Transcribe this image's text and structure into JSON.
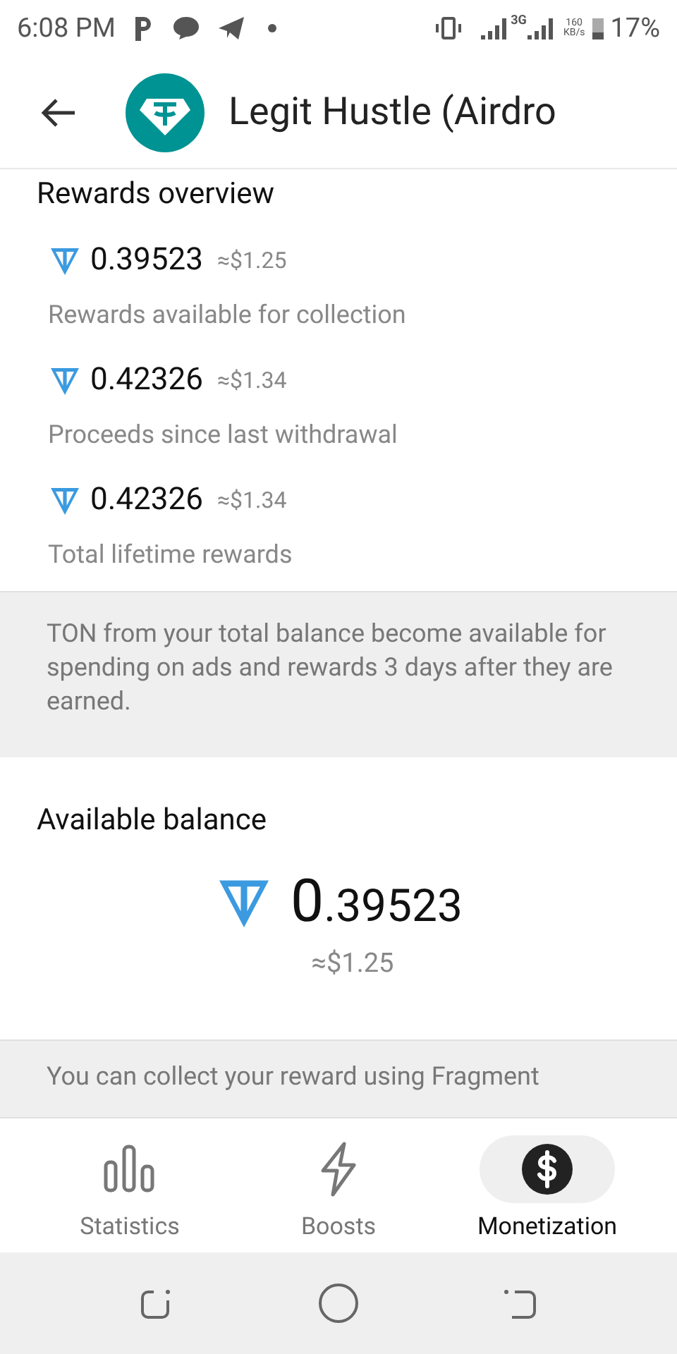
{
  "status_bar": {
    "time": "6:08 PM",
    "network": "3G",
    "speed": "160",
    "speed_unit": "KB/s",
    "battery": "17%"
  },
  "header": {
    "title": "Legit Hustle (Airdro"
  },
  "rewards": {
    "title": "Rewards overview",
    "items": [
      {
        "amount": "0.39523",
        "usd": "≈$1.25",
        "label": "Rewards available for collection"
      },
      {
        "amount": "0.42326",
        "usd": "≈$1.34",
        "label": "Proceeds since last withdrawal"
      },
      {
        "amount": "0.42326",
        "usd": "≈$1.34",
        "label": "Total lifetime rewards"
      }
    ]
  },
  "note": "TON from your total balance become available for spending on ads and rewards 3 days after they are earned.",
  "balance": {
    "title": "Available balance",
    "integer": "0",
    "fraction": ".39523",
    "usd": "≈$1.25"
  },
  "cut_note": "You can collect your reward using Fragment",
  "tabs": [
    {
      "label": "Statistics",
      "kind": "stats",
      "selected": false
    },
    {
      "label": "Boosts",
      "kind": "boosts",
      "selected": false
    },
    {
      "label": "Monetization",
      "kind": "money",
      "selected": true
    }
  ]
}
